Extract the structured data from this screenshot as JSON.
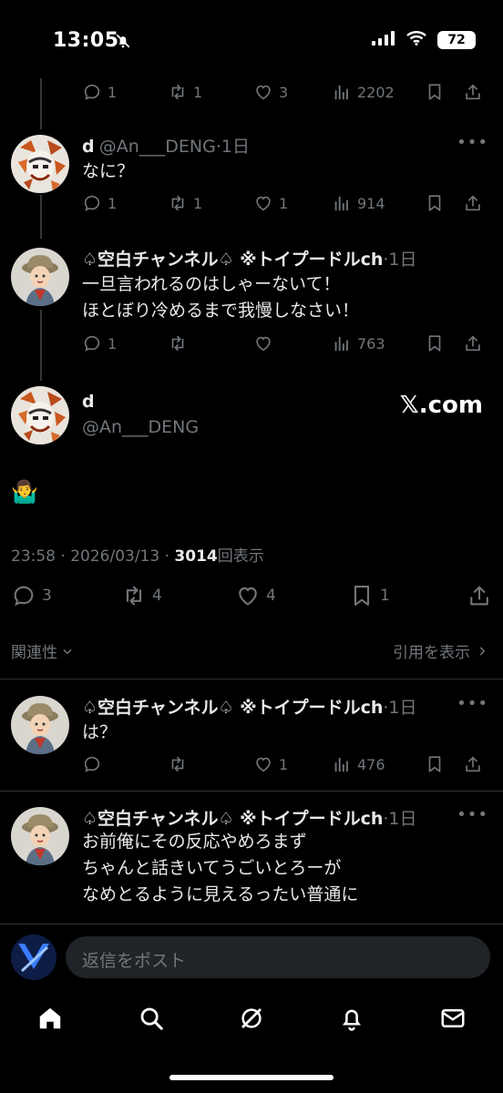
{
  "status_bar": {
    "time": "13:05",
    "battery": "72"
  },
  "partial_top": {
    "reply_count": "1",
    "repost_count": "1",
    "like_count": "3",
    "view_count": "2202"
  },
  "replies_above": [
    {
      "name": "d",
      "handle": "@An___DENG",
      "age": "·1日",
      "text": [
        "なに？"
      ],
      "reply_count": "1",
      "repost_count": "1",
      "like_count": "1",
      "view_count": "914"
    },
    {
      "name": "♤空白チャンネル♤ ※トイプードルch",
      "handle": "",
      "age": "·1日",
      "text": [
        "一旦言われるのはしゃーないて！",
        "ほとぼり冷めるまで我慢しなさい！"
      ],
      "reply_count": "1",
      "repost_count": "",
      "like_count": "",
      "view_count": "763"
    }
  ],
  "main_post": {
    "name": "d",
    "handle": "@An___DENG",
    "watermark": "𝕏.com",
    "body": "🤷‍♂️",
    "timestamp": "23:58 · 2026/03/13 · ",
    "views": "3014",
    "views_label": "回表示",
    "reply_count": "3",
    "repost_count": "4",
    "like_count": "4",
    "bookmark_count": "1"
  },
  "sort": {
    "label": "関連性",
    "quotes_label": "引用を表示"
  },
  "replies_below": [
    {
      "name": "♤空白チャンネル♤ ※トイプードルch",
      "age": "·1日",
      "text": [
        "は？"
      ],
      "reply_count": "",
      "repost_count": "",
      "like_count": "1",
      "view_count": "476"
    },
    {
      "name": "♤空白チャンネル♤ ※トイプードルch",
      "age": "·1日",
      "text": [
        "お前俺にその反応やめろまず",
        "ちゃんと話きいてうごいとろーが",
        "なめとるように見えるったい普通に"
      ]
    }
  ],
  "composer": {
    "placeholder": "返信をポスト"
  },
  "icons": {
    "home": "home-icon",
    "search": "search-icon",
    "grok": "grok-icon",
    "notifications": "bell-icon",
    "messages": "mail-icon"
  },
  "colors": {
    "background": "#000000",
    "text": "#e7e9ea",
    "secondary": "#71767b",
    "divider": "#2f3336"
  }
}
